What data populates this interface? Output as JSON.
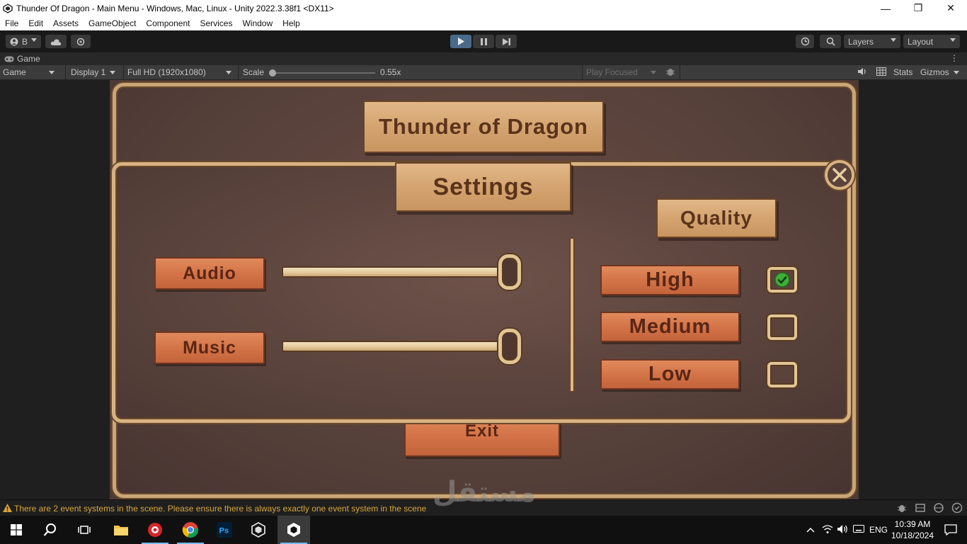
{
  "window": {
    "title": "Thunder Of Dragon - Main Menu - Windows, Mac, Linux - Unity 2022.3.38f1 <DX11>",
    "minimize": "—",
    "maximize": "❐",
    "close": "✕"
  },
  "menu": [
    "File",
    "Edit",
    "Assets",
    "GameObject",
    "Component",
    "Services",
    "Window",
    "Help"
  ],
  "toolbar": {
    "account_label": "B",
    "layers_label": "Layers",
    "layout_label": "Layout"
  },
  "game_tab": {
    "label": "Game",
    "mode": "Game",
    "display": "Display 1",
    "resolution": "Full HD (1920x1080)",
    "scale_label": "Scale",
    "scale_value": "0.55x",
    "scale_fraction": 0.0,
    "play_focused": "Play Focused",
    "stats": "Stats",
    "gizmos": "Gizmos"
  },
  "game": {
    "title": "Thunder of Dragon",
    "settings_title": "Settings",
    "quality_title": "Quality",
    "audio_label": "Audio",
    "music_label": "Music",
    "audio_level": 1.0,
    "music_level": 1.0,
    "quality_options": [
      {
        "label": "High",
        "checked": true
      },
      {
        "label": "Medium",
        "checked": false
      },
      {
        "label": "Low",
        "checked": false
      }
    ],
    "exit_label": "Exit"
  },
  "console": {
    "message": "There are 2 event systems in the scene. Please ensure there is always exactly one event system in the scene"
  },
  "watermark": {
    "arabic": "مستقل",
    "latin": "mostaql.com"
  },
  "taskbar": {
    "language": "ENG",
    "time": "10:39 AM",
    "date": "10/18/2024"
  },
  "colors": {
    "warning": "#d7a53a",
    "plank_light": "#d4a470",
    "plank_orange": "#d27246",
    "text_brown": "#5b331b",
    "check_green": "#3fae3a"
  }
}
